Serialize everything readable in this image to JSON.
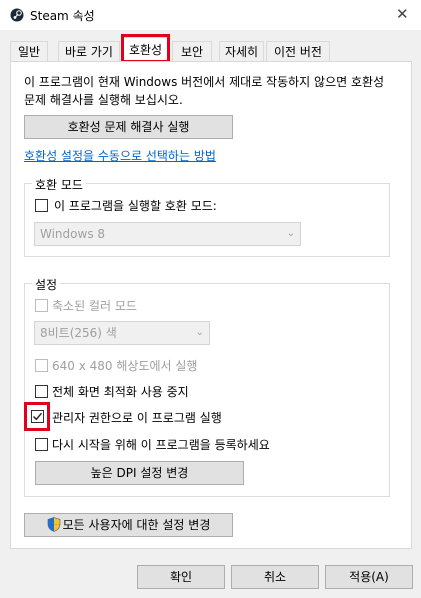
{
  "window": {
    "title": "Steam 속성",
    "close_glyph": "✕",
    "icon": "steam-icon"
  },
  "tabs": [
    {
      "label": "일반",
      "active": false
    },
    {
      "label": "바로 가기",
      "active": false
    },
    {
      "label": "호환성",
      "active": true
    },
    {
      "label": "보안",
      "active": false
    },
    {
      "label": "자세히",
      "active": false
    },
    {
      "label": "이전 버전",
      "active": false
    }
  ],
  "compat": {
    "description": "이 프로그램이 현재 Windows 버전에서 제대로 작동하지 않으면 호환성 문제 해결사를 실행해 보십시오.",
    "troubleshooter_button": "호환성 문제 해결사 실행",
    "manual_link": "호환성 설정을 수동으로 선택하는 방법"
  },
  "compat_mode": {
    "group_label": "호환 모드",
    "checkbox_label": "이 프로그램을 실행할 호환 모드:",
    "checked": false,
    "os_select_value": "Windows 8"
  },
  "settings": {
    "group_label": "설정",
    "reduced_color": {
      "label": "축소된 컬러 모드",
      "checked": false,
      "enabled": false
    },
    "color_select_value": "8비트(256) 색",
    "res_640": {
      "label": "640 x 480 해상도에서 실행",
      "checked": false,
      "enabled": false
    },
    "disable_fullscreen": {
      "label": "전체 화면 최적화 사용 중지",
      "checked": false,
      "enabled": true
    },
    "run_as_admin": {
      "label": "관리자 권한으로 이 프로그램 실행",
      "checked": true,
      "enabled": true
    },
    "register_restart": {
      "label": "다시 시작을 위해 이 프로그램을 등록하세요",
      "checked": false,
      "enabled": true
    },
    "high_dpi_button": "높은 DPI 설정 변경"
  },
  "all_users_button": {
    "label": "모든 사용자에 대한 설정 변경",
    "icon": "uac-shield-icon"
  },
  "footer": {
    "ok": "확인",
    "cancel": "취소",
    "apply": "적용(A)"
  },
  "colors": {
    "highlight": "#e0001a",
    "link": "#0066cc"
  }
}
